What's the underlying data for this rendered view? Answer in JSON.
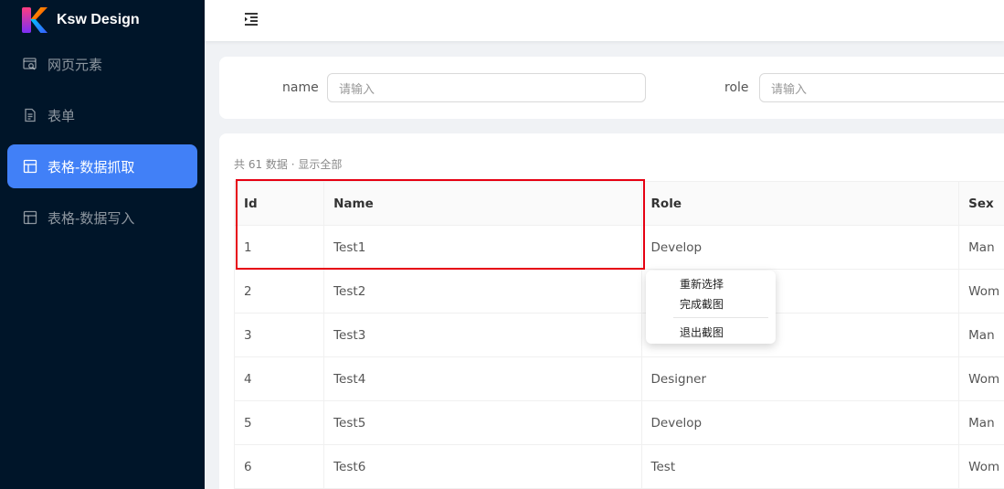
{
  "brand": {
    "name": "Ksw Design"
  },
  "sidebar": {
    "items": [
      {
        "label": "网页元素",
        "icon": "element-search-icon",
        "active": false
      },
      {
        "label": "表单",
        "icon": "file-text-icon",
        "active": false
      },
      {
        "label": "表格-数据抓取",
        "icon": "table-icon",
        "active": true
      },
      {
        "label": "表格-数据写入",
        "icon": "table-icon",
        "active": false
      }
    ]
  },
  "header": {
    "fold_icon": "menu-fold-icon"
  },
  "search": {
    "name_label": "name",
    "name_placeholder": "请输入",
    "role_label": "role",
    "role_placeholder": "请输入"
  },
  "table": {
    "summary": "共 61 数据 · 显示全部",
    "columns": [
      "Id",
      "Name",
      "Role",
      "Sex"
    ],
    "rows": [
      [
        "1",
        "Test1",
        "Develop",
        "Man"
      ],
      [
        "2",
        "Test2",
        "",
        "Wom"
      ],
      [
        "3",
        "Test3",
        "",
        "Man"
      ],
      [
        "4",
        "Test4",
        "Designer",
        "Wom"
      ],
      [
        "5",
        "Test5",
        "Develop",
        "Man"
      ],
      [
        "6",
        "Test6",
        "Test",
        "Wom"
      ]
    ]
  },
  "context_menu": {
    "reselect": "重新选择",
    "finish": "完成截图",
    "exit": "退出截图"
  },
  "colors": {
    "sidebar_bg": "#001529",
    "active_item": "#4180f7",
    "selection_border": "#e60012"
  }
}
